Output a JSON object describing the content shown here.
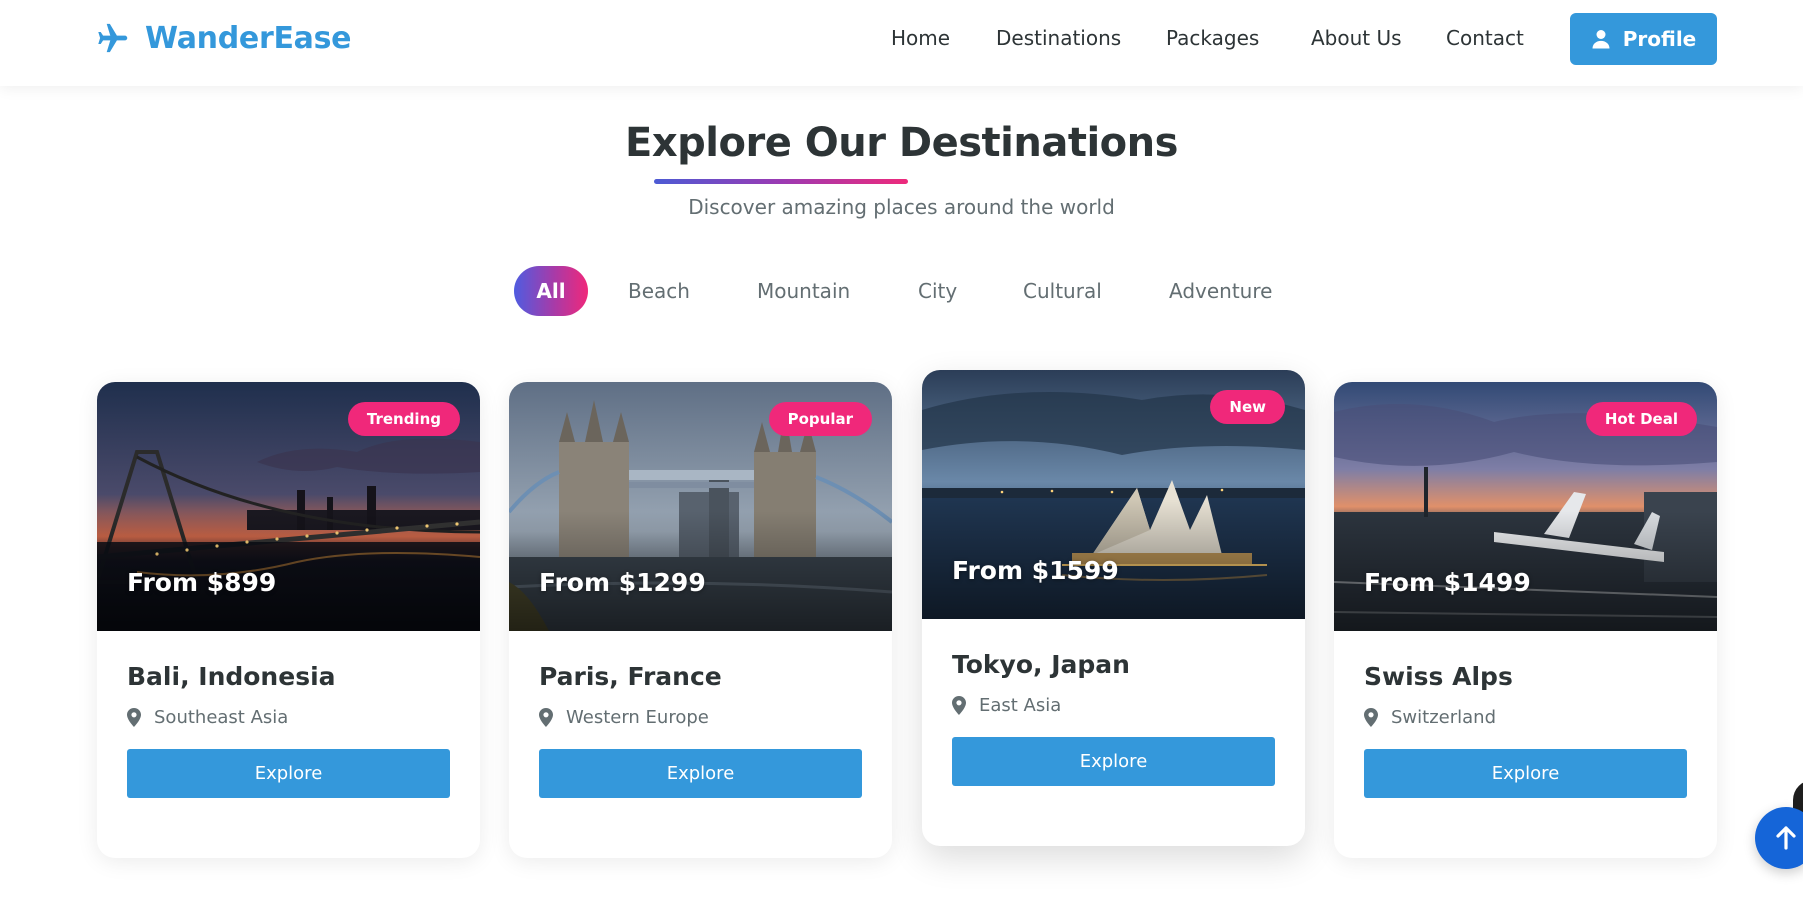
{
  "brand": {
    "name": "WanderEase",
    "icon": "plane-icon",
    "color": "#3498db"
  },
  "nav": {
    "links": [
      "Home",
      "Destinations",
      "Packages",
      "About Us",
      "Contact"
    ],
    "profile_label": "Profile",
    "profile_icon": "user-icon"
  },
  "section": {
    "title": "Explore Our Destinations",
    "subtitle": "Discover amazing places around the world"
  },
  "filters": {
    "items": [
      "All",
      "Beach",
      "Mountain",
      "City",
      "Cultural",
      "Adventure"
    ],
    "active": "All"
  },
  "cards": [
    {
      "badge": "Trending",
      "price": "From $899",
      "title": "Bali, Indonesia",
      "location": "Southeast Asia",
      "button": "Explore"
    },
    {
      "badge": "Popular",
      "price": "From $1299",
      "title": "Paris, France",
      "location": "Western Europe",
      "button": "Explore"
    },
    {
      "badge": "New",
      "price": "From $1599",
      "title": "Tokyo, Japan",
      "location": "East Asia",
      "button": "Explore"
    },
    {
      "badge": "Hot Deal",
      "price": "From $1499",
      "title": "Swiss Alps",
      "location": "Switzerland",
      "button": "Explore"
    }
  ],
  "colors": {
    "primary": "#3498db",
    "accent": "#f0287a",
    "text": "#2d3436",
    "muted": "#636e72"
  }
}
